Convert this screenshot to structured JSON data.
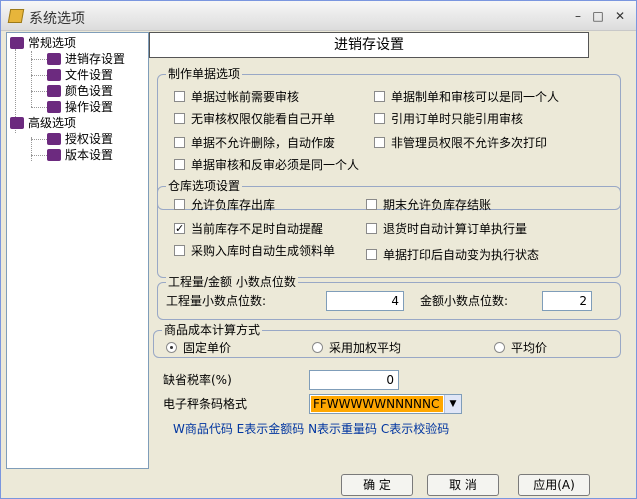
{
  "window": {
    "title": "系统选项",
    "min": "–",
    "max": "□",
    "close": "✕"
  },
  "tree": {
    "root1": "常规选项",
    "children1": [
      "进销存设置",
      "文件设置",
      "颜色设置",
      "操作设置"
    ],
    "root2": "高级选项",
    "children2": [
      "授权设置",
      "版本设置"
    ]
  },
  "section_title": "进销存设置",
  "bill": {
    "legend": "制作单据选项",
    "opts": [
      "单据过帐前需要审核",
      "单据制单和审核可以是同一个人",
      "无审核权限仅能看自己开单",
      "引用订单时只能引用审核",
      "单据不允许删除，自动作废",
      "非管理员权限不允许多次打印",
      "单据审核和反审必须是同一个人"
    ]
  },
  "stock": {
    "legend": "仓库选项设置",
    "opts": [
      "允许负库存出库",
      "期末允许负库存结账",
      "当前库存不足时自动提醒",
      "退货时自动计算订单执行量",
      "采购入库时自动生成领料单",
      "单据打印后自动变为执行状态"
    ]
  },
  "decimal": {
    "legend": "工程量/金额  小数点位数",
    "qty_label": "工程量小数点位数:",
    "qty_value": "4",
    "amt_label": "金额小数点位数:",
    "amt_value": "2"
  },
  "cost": {
    "legend": "商品成本计算方式",
    "opts": [
      "固定单价",
      "采用加权平均",
      "平均价"
    ],
    "selected_index": 0
  },
  "tax": {
    "label": "缺省税率(%)",
    "value": "0"
  },
  "barcode": {
    "label": "电子秤条码格式",
    "value": "FFWWWWWNNNNNC",
    "hint": "W商品代码 E表示金额码 N表示重量码 C表示校验码"
  },
  "buttons": {
    "ok": "确  定",
    "cancel": "取  消",
    "apply": "应用(A)"
  }
}
